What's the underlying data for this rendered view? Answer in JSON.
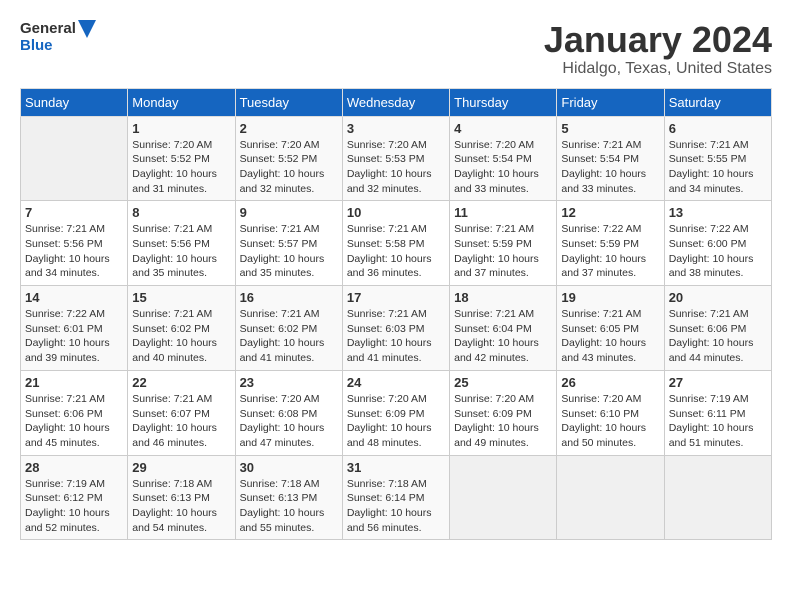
{
  "header": {
    "logo_general": "General",
    "logo_blue": "Blue",
    "month": "January 2024",
    "location": "Hidalgo, Texas, United States"
  },
  "weekdays": [
    "Sunday",
    "Monday",
    "Tuesday",
    "Wednesday",
    "Thursday",
    "Friday",
    "Saturday"
  ],
  "weeks": [
    [
      {
        "day": "",
        "sunrise": "",
        "sunset": "",
        "daylight": ""
      },
      {
        "day": "1",
        "sunrise": "Sunrise: 7:20 AM",
        "sunset": "Sunset: 5:52 PM",
        "daylight": "Daylight: 10 hours and 31 minutes."
      },
      {
        "day": "2",
        "sunrise": "Sunrise: 7:20 AM",
        "sunset": "Sunset: 5:52 PM",
        "daylight": "Daylight: 10 hours and 32 minutes."
      },
      {
        "day": "3",
        "sunrise": "Sunrise: 7:20 AM",
        "sunset": "Sunset: 5:53 PM",
        "daylight": "Daylight: 10 hours and 32 minutes."
      },
      {
        "day": "4",
        "sunrise": "Sunrise: 7:20 AM",
        "sunset": "Sunset: 5:54 PM",
        "daylight": "Daylight: 10 hours and 33 minutes."
      },
      {
        "day": "5",
        "sunrise": "Sunrise: 7:21 AM",
        "sunset": "Sunset: 5:54 PM",
        "daylight": "Daylight: 10 hours and 33 minutes."
      },
      {
        "day": "6",
        "sunrise": "Sunrise: 7:21 AM",
        "sunset": "Sunset: 5:55 PM",
        "daylight": "Daylight: 10 hours and 34 minutes."
      }
    ],
    [
      {
        "day": "7",
        "sunrise": "Sunrise: 7:21 AM",
        "sunset": "Sunset: 5:56 PM",
        "daylight": "Daylight: 10 hours and 34 minutes."
      },
      {
        "day": "8",
        "sunrise": "Sunrise: 7:21 AM",
        "sunset": "Sunset: 5:56 PM",
        "daylight": "Daylight: 10 hours and 35 minutes."
      },
      {
        "day": "9",
        "sunrise": "Sunrise: 7:21 AM",
        "sunset": "Sunset: 5:57 PM",
        "daylight": "Daylight: 10 hours and 35 minutes."
      },
      {
        "day": "10",
        "sunrise": "Sunrise: 7:21 AM",
        "sunset": "Sunset: 5:58 PM",
        "daylight": "Daylight: 10 hours and 36 minutes."
      },
      {
        "day": "11",
        "sunrise": "Sunrise: 7:21 AM",
        "sunset": "Sunset: 5:59 PM",
        "daylight": "Daylight: 10 hours and 37 minutes."
      },
      {
        "day": "12",
        "sunrise": "Sunrise: 7:22 AM",
        "sunset": "Sunset: 5:59 PM",
        "daylight": "Daylight: 10 hours and 37 minutes."
      },
      {
        "day": "13",
        "sunrise": "Sunrise: 7:22 AM",
        "sunset": "Sunset: 6:00 PM",
        "daylight": "Daylight: 10 hours and 38 minutes."
      }
    ],
    [
      {
        "day": "14",
        "sunrise": "Sunrise: 7:22 AM",
        "sunset": "Sunset: 6:01 PM",
        "daylight": "Daylight: 10 hours and 39 minutes."
      },
      {
        "day": "15",
        "sunrise": "Sunrise: 7:21 AM",
        "sunset": "Sunset: 6:02 PM",
        "daylight": "Daylight: 10 hours and 40 minutes."
      },
      {
        "day": "16",
        "sunrise": "Sunrise: 7:21 AM",
        "sunset": "Sunset: 6:02 PM",
        "daylight": "Daylight: 10 hours and 41 minutes."
      },
      {
        "day": "17",
        "sunrise": "Sunrise: 7:21 AM",
        "sunset": "Sunset: 6:03 PM",
        "daylight": "Daylight: 10 hours and 41 minutes."
      },
      {
        "day": "18",
        "sunrise": "Sunrise: 7:21 AM",
        "sunset": "Sunset: 6:04 PM",
        "daylight": "Daylight: 10 hours and 42 minutes."
      },
      {
        "day": "19",
        "sunrise": "Sunrise: 7:21 AM",
        "sunset": "Sunset: 6:05 PM",
        "daylight": "Daylight: 10 hours and 43 minutes."
      },
      {
        "day": "20",
        "sunrise": "Sunrise: 7:21 AM",
        "sunset": "Sunset: 6:06 PM",
        "daylight": "Daylight: 10 hours and 44 minutes."
      }
    ],
    [
      {
        "day": "21",
        "sunrise": "Sunrise: 7:21 AM",
        "sunset": "Sunset: 6:06 PM",
        "daylight": "Daylight: 10 hours and 45 minutes."
      },
      {
        "day": "22",
        "sunrise": "Sunrise: 7:21 AM",
        "sunset": "Sunset: 6:07 PM",
        "daylight": "Daylight: 10 hours and 46 minutes."
      },
      {
        "day": "23",
        "sunrise": "Sunrise: 7:20 AM",
        "sunset": "Sunset: 6:08 PM",
        "daylight": "Daylight: 10 hours and 47 minutes."
      },
      {
        "day": "24",
        "sunrise": "Sunrise: 7:20 AM",
        "sunset": "Sunset: 6:09 PM",
        "daylight": "Daylight: 10 hours and 48 minutes."
      },
      {
        "day": "25",
        "sunrise": "Sunrise: 7:20 AM",
        "sunset": "Sunset: 6:09 PM",
        "daylight": "Daylight: 10 hours and 49 minutes."
      },
      {
        "day": "26",
        "sunrise": "Sunrise: 7:20 AM",
        "sunset": "Sunset: 6:10 PM",
        "daylight": "Daylight: 10 hours and 50 minutes."
      },
      {
        "day": "27",
        "sunrise": "Sunrise: 7:19 AM",
        "sunset": "Sunset: 6:11 PM",
        "daylight": "Daylight: 10 hours and 51 minutes."
      }
    ],
    [
      {
        "day": "28",
        "sunrise": "Sunrise: 7:19 AM",
        "sunset": "Sunset: 6:12 PM",
        "daylight": "Daylight: 10 hours and 52 minutes."
      },
      {
        "day": "29",
        "sunrise": "Sunrise: 7:18 AM",
        "sunset": "Sunset: 6:13 PM",
        "daylight": "Daylight: 10 hours and 54 minutes."
      },
      {
        "day": "30",
        "sunrise": "Sunrise: 7:18 AM",
        "sunset": "Sunset: 6:13 PM",
        "daylight": "Daylight: 10 hours and 55 minutes."
      },
      {
        "day": "31",
        "sunrise": "Sunrise: 7:18 AM",
        "sunset": "Sunset: 6:14 PM",
        "daylight": "Daylight: 10 hours and 56 minutes."
      },
      {
        "day": "",
        "sunrise": "",
        "sunset": "",
        "daylight": ""
      },
      {
        "day": "",
        "sunrise": "",
        "sunset": "",
        "daylight": ""
      },
      {
        "day": "",
        "sunrise": "",
        "sunset": "",
        "daylight": ""
      }
    ]
  ]
}
